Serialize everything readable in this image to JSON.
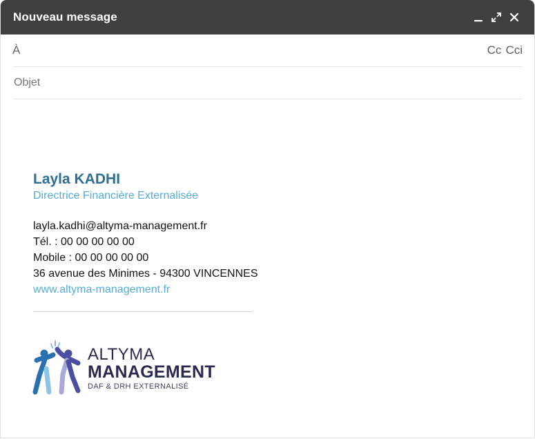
{
  "window": {
    "title": "Nouveau message",
    "controls": {
      "minimize": "minimize-icon",
      "fullscreen": "expand-icon",
      "close": "close-icon"
    }
  },
  "fields": {
    "to_label": "À",
    "to_value": "",
    "cc_label": "Cc",
    "bcc_label": "Cci",
    "subject_placeholder": "Objet",
    "subject_value": ""
  },
  "signature": {
    "name": "Layla KADHI",
    "role": "Directrice Financière Externalisée",
    "email": "layla.kadhi@altyma-management.fr",
    "phone": "Tél. : 00 00 00 00 00",
    "mobile": "Mobile : 00 00 00 00 00",
    "address": "36 avenue des Minimes - 94300 VINCENNES",
    "website": "www.altyma-management.fr",
    "logo": {
      "line1": "ALTYMA",
      "line2": "MANAGEMENT",
      "tagline": "DAF & DRH EXTERNALISÉ"
    }
  },
  "colors": {
    "titlebar": "#404040",
    "name": "#2f6f94",
    "accent": "#57abd6",
    "brand_dark": "#2b2b52",
    "logo_blue": "#2a6fb0",
    "logo_light_blue": "#8cc4e6",
    "logo_purple": "#4b4fa0",
    "logo_lavender": "#a9a8d8"
  }
}
